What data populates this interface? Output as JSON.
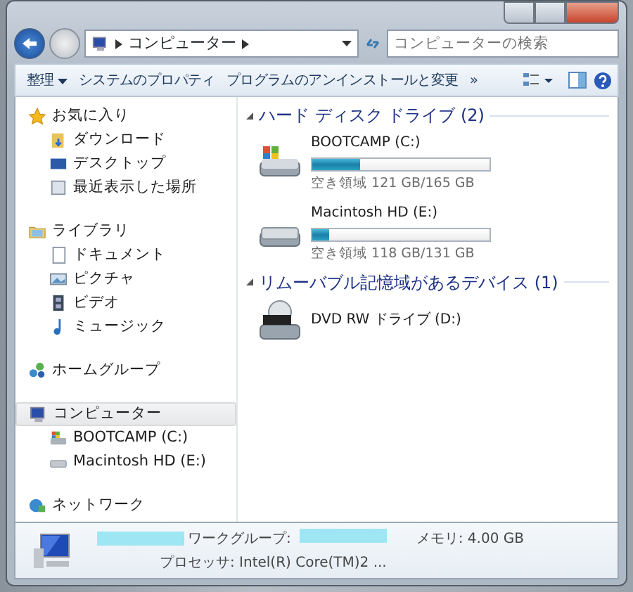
{
  "address": {
    "crumbs": [
      "コンピューター"
    ]
  },
  "search": {
    "placeholder": "コンピューターの検索"
  },
  "toolbar": {
    "items": [
      "整理",
      "システムのプロパティ",
      "プログラムのアンインストールと変更"
    ],
    "more": "»"
  },
  "sidebar": {
    "groups": [
      {
        "kind": "favorites",
        "label": "お気に入り",
        "selected": false,
        "children": [
          {
            "kind": "download",
            "label": "ダウンロード"
          },
          {
            "kind": "desktop",
            "label": "デスクトップ"
          },
          {
            "kind": "recent",
            "label": "最近表示した場所"
          }
        ]
      },
      {
        "kind": "library",
        "label": "ライブラリ",
        "selected": false,
        "children": [
          {
            "kind": "document",
            "label": "ドキュメント"
          },
          {
            "kind": "picture",
            "label": "ピクチャ"
          },
          {
            "kind": "video",
            "label": "ビデオ"
          },
          {
            "kind": "music",
            "label": "ミュージック"
          }
        ]
      },
      {
        "kind": "homegroup",
        "label": "ホームグループ",
        "selected": false
      },
      {
        "kind": "computer",
        "label": "コンピューター",
        "selected": true,
        "children": [
          {
            "kind": "windrive",
            "label": "BOOTCAMP (C:)"
          },
          {
            "kind": "drive",
            "label": "Macintosh HD (E:)"
          }
        ]
      },
      {
        "kind": "network",
        "label": "ネットワーク",
        "selected": false
      }
    ]
  },
  "sections": [
    {
      "title": "ハード ディスク ドライブ (2)",
      "items": [
        {
          "kind": "windrive",
          "name": "BOOTCAMP (C:)",
          "level": 0.267,
          "free": "空き領域 121 GB/165 GB"
        },
        {
          "kind": "drive",
          "name": "Macintosh HD (E:)",
          "level": 0.099,
          "free": "空き領域 118 GB/131 GB"
        }
      ]
    },
    {
      "title": "リムーバブル記憶域があるデバイス (1)",
      "items": [
        {
          "kind": "dvd",
          "name": "DVD RW ドライブ (D:)"
        }
      ]
    }
  ],
  "details": {
    "workgroup_label": "ワークグループ:",
    "memory": "メモリ: 4.00 GB",
    "processor": "プロセッサ: Intel(R) Core(TM)2 ..."
  }
}
